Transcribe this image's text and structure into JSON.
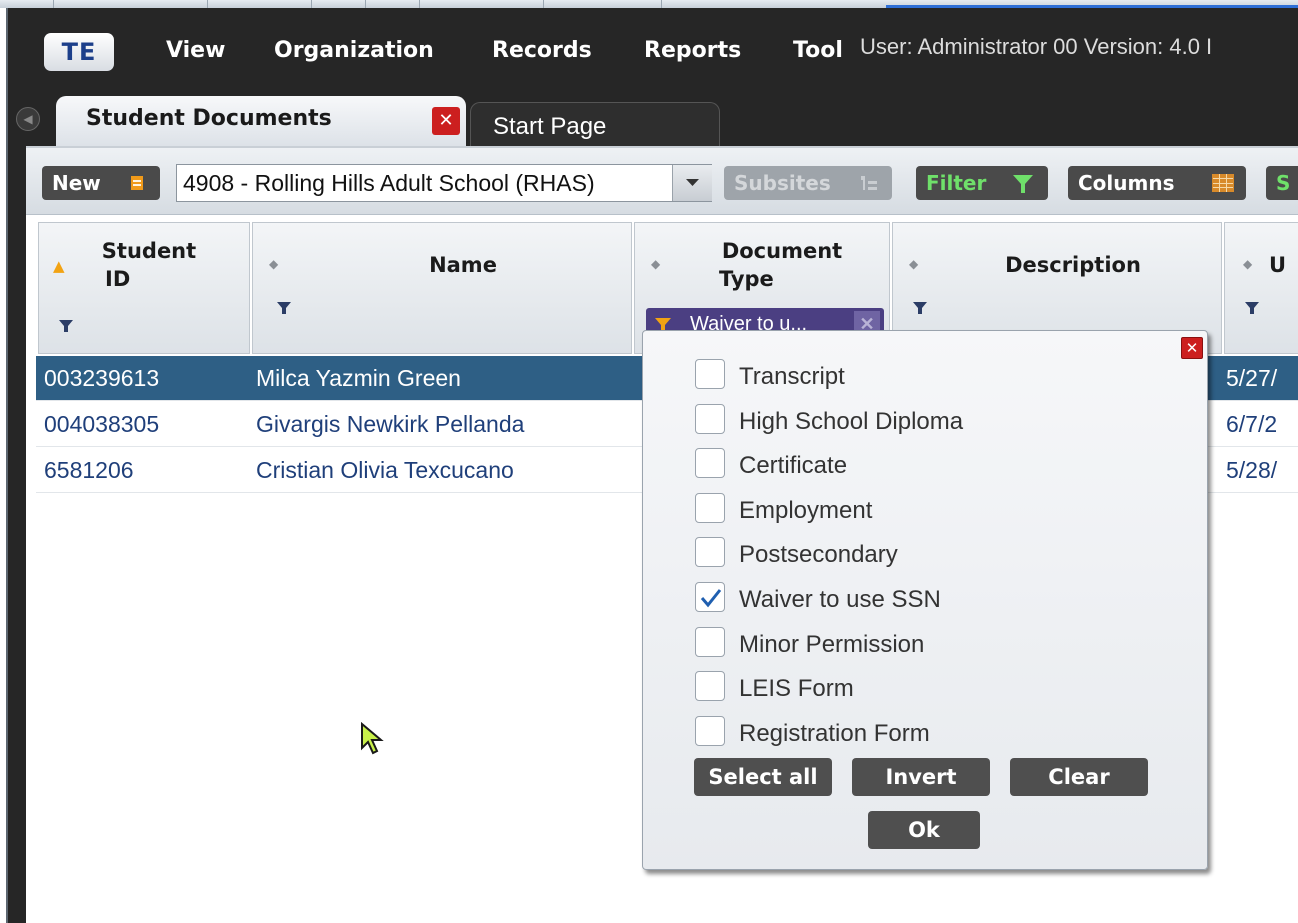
{
  "menu": {
    "logo": "TE",
    "items": [
      "View",
      "Organization",
      "Records",
      "Reports",
      "Tool"
    ],
    "user_info": "User: Administrator 00   Version: 4.0 I"
  },
  "tabs": {
    "active": "Student Documents",
    "inactive": "Start Page"
  },
  "toolbar": {
    "new_label": "New",
    "site_value": "4908 - Rolling Hills Adult School (RHAS)",
    "subsites_label": "Subsites",
    "filter_label": "Filter",
    "columns_label": "Columns",
    "partial_label": "S"
  },
  "grid": {
    "columns": [
      {
        "title_line1": "Student",
        "title_line2": "ID",
        "sort": "asc"
      },
      {
        "title_line1": "Name",
        "title_line2": "",
        "sort": "none"
      },
      {
        "title_line1": "Document",
        "title_line2": "Type",
        "sort": "none"
      },
      {
        "title_line1": "Description",
        "title_line2": "",
        "sort": "none"
      },
      {
        "title_line1": "U",
        "title_line2": "",
        "sort": "none"
      }
    ],
    "active_filter_chip": "Waiver to u...",
    "rows": [
      {
        "student_id": "003239613",
        "name": "Milca Yazmin Green",
        "date": "5/27/",
        "selected": true
      },
      {
        "student_id": "004038305",
        "name": "Givargis Newkirk Pellanda",
        "date": "6/7/2",
        "selected": false
      },
      {
        "student_id": "6581206",
        "name": "Cristian Olivia Texcucano",
        "date": "5/28/",
        "selected": false
      }
    ]
  },
  "filter_popup": {
    "options": [
      {
        "label": "Transcript",
        "checked": false
      },
      {
        "label": "High School Diploma",
        "checked": false
      },
      {
        "label": "Certificate",
        "checked": false
      },
      {
        "label": "Employment",
        "checked": false
      },
      {
        "label": "Postsecondary",
        "checked": false
      },
      {
        "label": "Waiver to use SSN",
        "checked": true
      },
      {
        "label": "Minor Permission",
        "checked": false
      },
      {
        "label": "LEIS Form",
        "checked": false
      },
      {
        "label": "Registration Form",
        "checked": false
      }
    ],
    "select_all_label": "Select all",
    "invert_label": "Invert",
    "clear_label": "Clear",
    "ok_label": "Ok"
  },
  "colors": {
    "selected_row": "#2e5f85",
    "row_text": "#1f3f7a",
    "chip": "#4b3f82",
    "close_red": "#cc1f1f",
    "accent_green": "#6fe06a"
  }
}
